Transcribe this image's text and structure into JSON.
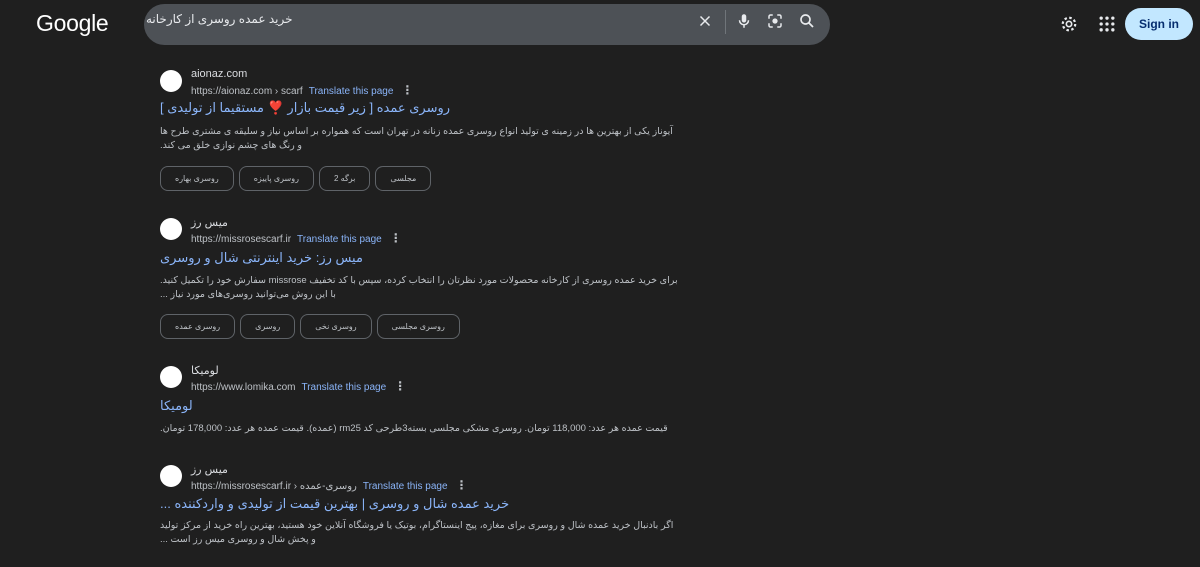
{
  "header": {
    "logo": "Google",
    "search_query": "خرید عمده روسری از کارخانه",
    "signin_label": "Sign in"
  },
  "results": [
    {
      "site_name": "aionaz.com",
      "url": "https://aionaz.com › scarf",
      "translate": "Translate this page",
      "title": "روسری عمده [ زیر قیمت بازار ❣️ مستقیما از تولیدی ]",
      "snippet": "آیوناز یکی از بهترین ها در زمینه ی تولید انواع روسری عمده زنانه در تهران است که همواره بر اساس نیاز و سلیقه ی مشتری طرح ها و رنگ های چشم نوازی خلق می کند.",
      "chips": [
        "روسری بهاره",
        "روسری پاییزه",
        "برگه 2",
        "مجلسی"
      ]
    },
    {
      "site_name": "میس رز",
      "url": "https://missrosescarf.ir",
      "translate": "Translate this page",
      "title": "میس رز: خرید اینترنتی شال و روسری",
      "snippet": "برای خرید عمده روسری از کارخانه محصولات مورد نظرتان را انتخاب کرده، سپس با کد تخفیف missrose سفارش خود را تکمیل کنید. با این روش می‌توانید روسری‌های مورد نیاز ...",
      "chips": [
        "روسری عمده",
        "روسری",
        "روسری نخی",
        "روسری مجلسی"
      ]
    },
    {
      "site_name": "لومیکا",
      "url": "https://www.lomika.com",
      "translate": "Translate this page",
      "title": "لومیکا",
      "snippet": "قیمت عمده هر عدد: 118,000 تومان. روسری مشکی مجلسی بسته3طرحی کد rm25 (عمده). قیمت عمده هر عدد: 178,000 تومان.",
      "chips": []
    },
    {
      "site_name": "میس رز",
      "url": "https://missrosescarf.ir › روسری-عمده",
      "translate": "Translate this page",
      "title": "خرید عمده شال و روسری | بهترین قیمت از تولیدی و واردکننده ...",
      "snippet": "اگر بادنبال خرید عمده شال و روسری برای مغازه، پیج اینستاگرام، بوتیک یا فروشگاه آنلاین خود هستید، بهترین راه خرید از مرکز تولید و پخش شال و روسری میس رز است ...",
      "chips": []
    }
  ]
}
